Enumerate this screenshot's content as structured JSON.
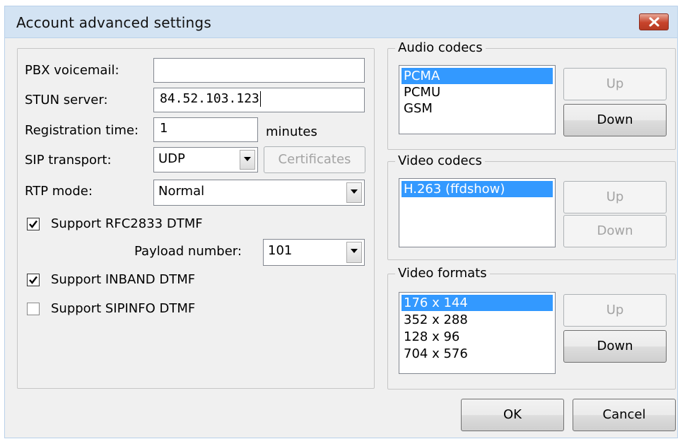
{
  "window": {
    "title": "Account advanced settings"
  },
  "left": {
    "pbx_voicemail": {
      "label": "PBX voicemail:",
      "value": ""
    },
    "stun_server": {
      "label": "STUN server:",
      "value": "84.52.103.123"
    },
    "registration_time": {
      "label": "Registration time:",
      "value": "1",
      "unit": "minutes"
    },
    "sip_transport": {
      "label": "SIP transport:",
      "value": "UDP",
      "certificates_label": "Certificates"
    },
    "rtp_mode": {
      "label": "RTP mode:",
      "value": "Normal"
    },
    "rfc2833": {
      "label": "Support RFC2833 DTMF",
      "checked": true
    },
    "payload": {
      "label": "Payload number:",
      "value": "101"
    },
    "inband": {
      "label": "Support INBAND DTMF",
      "checked": true
    },
    "sipinfo": {
      "label": "Support SIPINFO DTMF",
      "checked": false
    }
  },
  "audio_codecs": {
    "title": "Audio codecs",
    "items": [
      "PCMA",
      "PCMU",
      "GSM"
    ],
    "selected": "PCMA",
    "up_label": "Up",
    "down_label": "Down"
  },
  "video_codecs": {
    "title": "Video codecs",
    "items": [
      "H.263 (ffdshow)"
    ],
    "selected": "H.263 (ffdshow)",
    "up_label": "Up",
    "down_label": "Down"
  },
  "video_formats": {
    "title": "Video formats",
    "items": [
      "176 x 144",
      "352 x 288",
      "128 x 96",
      "704 x 576"
    ],
    "selected": "176 x 144",
    "up_label": "Up",
    "down_label": "Down"
  },
  "footer": {
    "ok_label": "OK",
    "cancel_label": "Cancel"
  }
}
